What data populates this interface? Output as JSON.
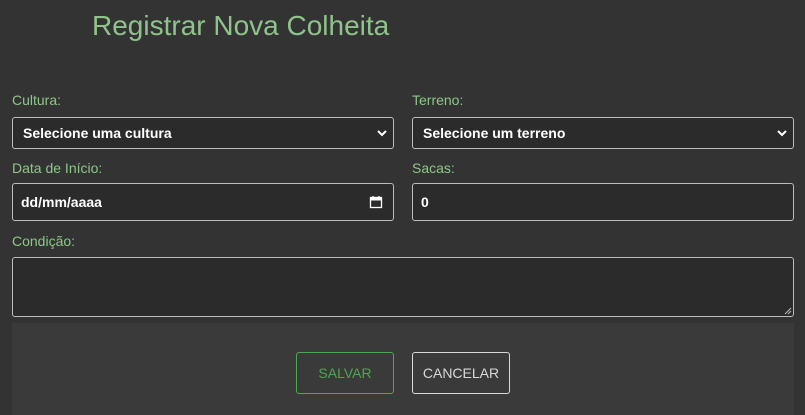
{
  "title": "Registrar Nova Colheita",
  "form": {
    "cultura": {
      "label": "Cultura:",
      "value": "Selecione uma cultura"
    },
    "terreno": {
      "label": "Terreno:",
      "value": "Selecione um terreno"
    },
    "data_inicio": {
      "label": "Data de Início:",
      "value": "dd/mm/aaaa"
    },
    "sacas": {
      "label": "Sacas:",
      "value": "0"
    },
    "condicao": {
      "label": "Condição:",
      "value": ""
    }
  },
  "actions": {
    "save_label": "SALVAR",
    "cancel_label": "CANCELAR"
  },
  "colors": {
    "background": "#333333",
    "accent": "#90c38c",
    "save_border": "#4aa84e"
  },
  "icons": {
    "select": "chevron-down-icon",
    "date": "calendar-icon",
    "textarea": "resize-handle-icon"
  }
}
